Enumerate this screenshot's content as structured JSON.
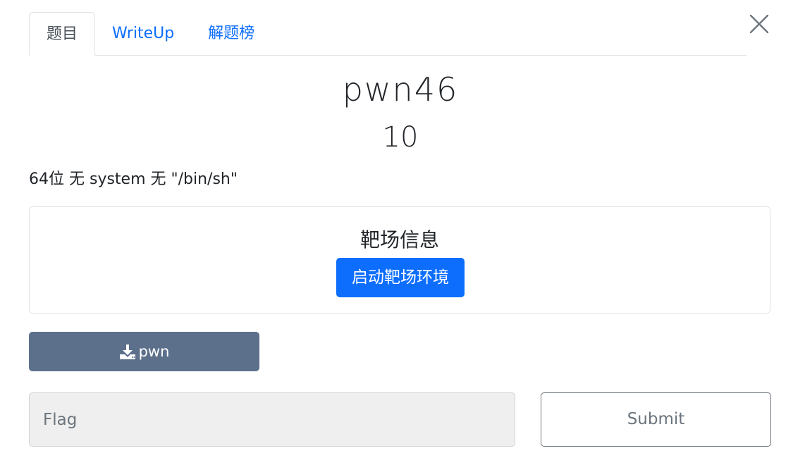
{
  "tabs": [
    {
      "label": "题目",
      "active": true
    },
    {
      "label": "WriteUp",
      "active": false
    },
    {
      "label": "解题榜",
      "active": false
    }
  ],
  "challenge": {
    "name": "pwn46",
    "points": "10",
    "description": "64位 无 system 无 \"/bin/sh\""
  },
  "range": {
    "heading": "靶场信息",
    "start_label": "启动靶场环境"
  },
  "download": {
    "icon": "download-icon",
    "label": "pwn"
  },
  "flag": {
    "placeholder": "Flag",
    "value": ""
  },
  "submit": {
    "label": "Submit"
  },
  "colors": {
    "primary": "#0d6efd",
    "download": "#5c708c",
    "secondary": "#6c757d"
  }
}
